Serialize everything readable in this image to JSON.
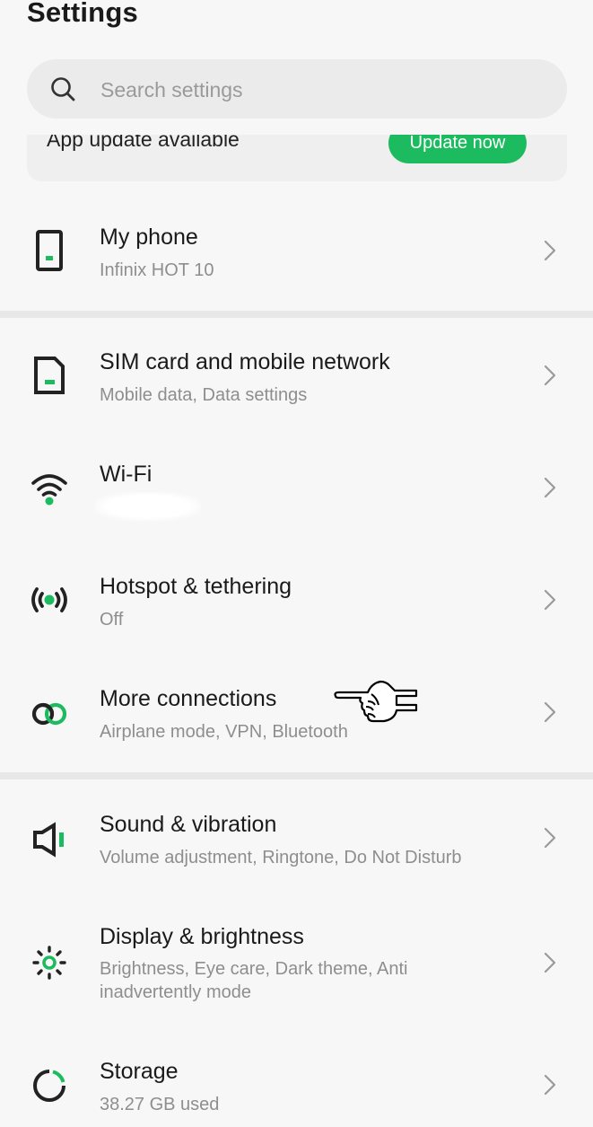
{
  "header": {
    "title": "Settings"
  },
  "search": {
    "placeholder": "Search settings"
  },
  "banner": {
    "text": "App update available",
    "button_label": "Update now"
  },
  "items": [
    {
      "icon": "phone-icon",
      "title": "My phone",
      "subtitle": "Infinix HOT 10"
    },
    {
      "icon": "sim-card-icon",
      "title": "SIM card and mobile network",
      "subtitle": "Mobile data, Data settings"
    },
    {
      "icon": "wifi-icon",
      "title": "Wi-Fi",
      "subtitle": ""
    },
    {
      "icon": "hotspot-icon",
      "title": "Hotspot & tethering",
      "subtitle": "Off"
    },
    {
      "icon": "link-icon",
      "title": "More connections",
      "subtitle": "Airplane mode, VPN, Bluetooth"
    },
    {
      "icon": "speaker-icon",
      "title": "Sound & vibration",
      "subtitle": "Volume adjustment, Ringtone, Do Not Disturb"
    },
    {
      "icon": "brightness-icon",
      "title": "Display & brightness",
      "subtitle": "Brightness, Eye care, Dark theme, Anti inadvertently mode"
    },
    {
      "icon": "storage-icon",
      "title": "Storage",
      "subtitle": "38.27 GB used"
    }
  ],
  "colors": {
    "accent": "#1dbb5f",
    "background": "#f7f7f7",
    "divider": "#e8e8e8",
    "icon_dark": "#222222"
  }
}
